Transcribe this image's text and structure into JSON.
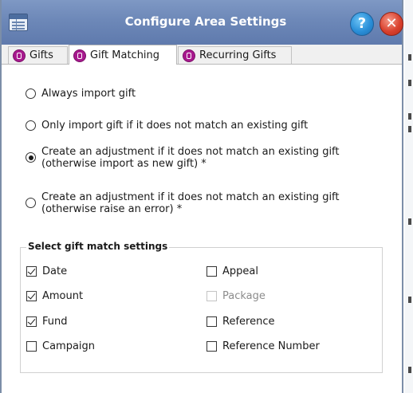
{
  "window": {
    "title": "Configure Area Settings",
    "help_label": "?",
    "close_label": "✕"
  },
  "tabs": [
    {
      "label": "Gifts",
      "active": false,
      "icon": "gift-icon"
    },
    {
      "label": "Gift Matching",
      "active": true,
      "icon": "gift-icon"
    },
    {
      "label": "Recurring Gifts",
      "active": false,
      "icon": "gift-icon"
    }
  ],
  "import_options": [
    {
      "label": "Always import gift",
      "selected": false
    },
    {
      "label": "Only import gift if it does not match an existing gift",
      "selected": false
    },
    {
      "label_line1": "Create an adjustment if it does not match an existing gift",
      "label_line2": "(otherwise import as new gift) *",
      "selected": true
    },
    {
      "label_line1": "Create an adjustment if it does not match an existing gift",
      "label_line2": "(otherwise raise an error) *",
      "selected": false
    }
  ],
  "match_settings": {
    "title": "Select gift match settings",
    "left": [
      {
        "label": "Date",
        "checked": true
      },
      {
        "label": "Amount",
        "checked": true
      },
      {
        "label": "Fund",
        "checked": true
      },
      {
        "label": "Campaign",
        "checked": false
      }
    ],
    "right": [
      {
        "label": "Appeal",
        "checked": false
      },
      {
        "label": "Package",
        "checked": false,
        "disabled": true
      },
      {
        "label": "Reference",
        "checked": false
      },
      {
        "label": "Reference Number",
        "checked": false
      }
    ]
  },
  "colors": {
    "titlebar": "#6d88b8",
    "tab_icon": "#a8198e",
    "help": "#2a8fd8",
    "close": "#d9412e"
  }
}
